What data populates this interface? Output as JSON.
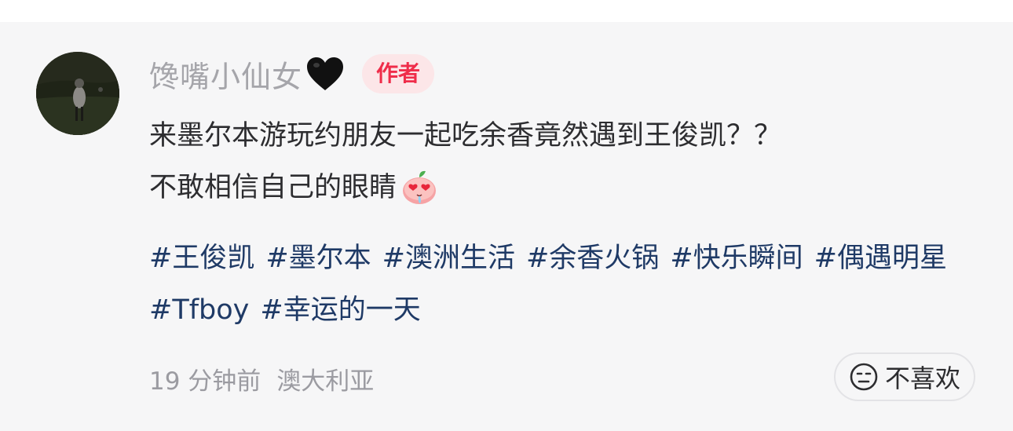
{
  "comment": {
    "avatar_icon": "user-avatar-photo",
    "username": "馋嘴小仙女",
    "username_icon": "black-heart-icon",
    "author_badge": "作者",
    "text_line1": "来墨尔本游玩约朋友一起吃余香竟然遇到王俊凯？？",
    "text_line2": "不敢相信自己的眼睛",
    "emoji_icon": "heart-eyes-peach-emoji",
    "hashtags": [
      "#王俊凯",
      "#墨尔本",
      "#澳洲生活",
      "#余香火锅",
      "#快乐瞬间",
      "#偶遇明星",
      "#Tfboy",
      "#幸运的一天"
    ],
    "time": "19 分钟前",
    "location": "澳大利亚",
    "dislike_label": "不喜欢",
    "dislike_icon": "neutral-face-icon"
  },
  "colors": {
    "background": "#f6f6f7",
    "username": "#a5a5aa",
    "badge_bg": "#fce6e8",
    "badge_text": "#ef2d4a",
    "hashtag": "#1f3a66",
    "meta": "#9b9ba1"
  }
}
